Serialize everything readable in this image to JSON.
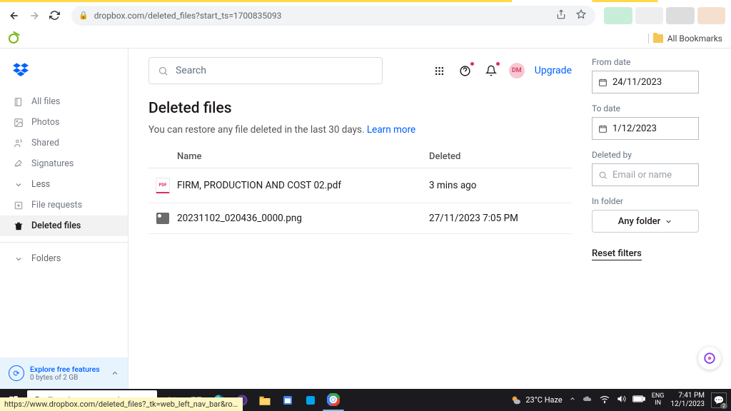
{
  "browser": {
    "url": "dropbox.com/deleted_files?start_ts=1700835093",
    "status_link": "https://www.dropbox.com/deleted_files?_tk=web_left_nav_bar&role=personal&di..."
  },
  "bookmarks": {
    "all": "All Bookmarks"
  },
  "sidebar": {
    "items": [
      {
        "label": "All files",
        "icon": "files"
      },
      {
        "label": "Photos",
        "icon": "photos"
      },
      {
        "label": "Shared",
        "icon": "shared"
      },
      {
        "label": "Signatures",
        "icon": "signatures"
      },
      {
        "label": "Less",
        "icon": "chevron"
      },
      {
        "label": "File requests",
        "icon": "filereq"
      },
      {
        "label": "Deleted files",
        "icon": "trash",
        "active": true
      }
    ],
    "folders_label": "Folders",
    "explore": {
      "title": "Explore free features",
      "subtitle": "0 bytes of 2 GB"
    }
  },
  "header": {
    "search_placeholder": "Search",
    "avatar": "DM",
    "upgrade": "Upgrade"
  },
  "page": {
    "title": "Deleted files",
    "subtitle": "You can restore any file deleted in the last 30 days. ",
    "learn_more": "Learn more",
    "columns": {
      "name": "Name",
      "deleted": "Deleted"
    },
    "rows": [
      {
        "name": "FIRM, PRODUCTION AND COST 02.pdf",
        "deleted": "3 mins ago",
        "type": "pdf"
      },
      {
        "name": "20231102_020436_0000.png",
        "deleted": "27/11/2023 7:05 PM",
        "type": "img"
      }
    ]
  },
  "filters": {
    "from_label": "From date",
    "from_value": "24/11/2023",
    "to_label": "To date",
    "to_value": "1/12/2023",
    "by_label": "Deleted by",
    "by_placeholder": "Email or name",
    "folder_label": "In folder",
    "folder_value": "Any folder",
    "reset": "Reset filters"
  },
  "taskbar": {
    "search_placeholder": "Type here to search",
    "weather": "23°C Haze",
    "lang1": "ENG",
    "lang2": "IN",
    "time": "7:41 PM",
    "date": "12/1/2023",
    "notif_count": "2"
  }
}
